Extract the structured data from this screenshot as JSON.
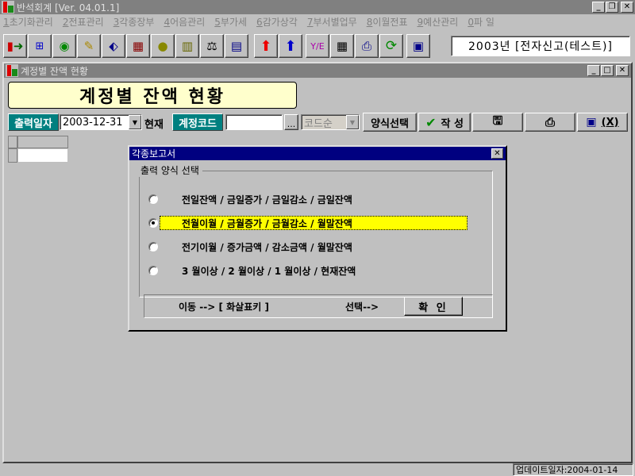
{
  "app": {
    "title": "반석회계 [Ver. 04.01.1]"
  },
  "menu": [
    {
      "key": "1",
      "label": "초기화관리"
    },
    {
      "key": "2",
      "label": "전표관리"
    },
    {
      "key": "3",
      "label": "각종장부"
    },
    {
      "key": "4",
      "label": "어음관리"
    },
    {
      "key": "5",
      "label": "부가세"
    },
    {
      "key": "6",
      "label": "감가상각"
    },
    {
      "key": "7",
      "label": "부서별업무"
    },
    {
      "key": "8",
      "label": "이월전표"
    },
    {
      "key": "9",
      "label": "예산관리"
    },
    {
      "key": "0",
      "label": "파 일"
    }
  ],
  "toolbar": {
    "icons": [
      "exit-icon",
      "org-chart-icon",
      "globe-icon",
      "pencil-edit-icon",
      "tag-icon",
      "abacus-icon",
      "coin-icon",
      "book-icon",
      "scale-icon",
      "grid-icon",
      "arrow-up-red-icon",
      "arrow-up-blue-icon",
      "year-end-icon",
      "calculator-icon",
      "printer-icon",
      "refresh-icon",
      "report-icon"
    ],
    "company": "2003년 [전자신고(테스트)]"
  },
  "window": {
    "title": "계정별 잔액 현황",
    "heading": "계정별 잔액 현황"
  },
  "filters": {
    "date_label": "출력일자",
    "date_value": "2003-12-31",
    "current_label": "현재",
    "code_label": "계정코드",
    "code_value": "",
    "lookup_label": "...",
    "sort_value": "코드순"
  },
  "actions": {
    "form_select": "양식선택",
    "write": "작 성",
    "exit": "(X)"
  },
  "dialog": {
    "title": "각종보고서",
    "group_label": "출력 양식 선택",
    "options": [
      {
        "label": "전일잔액 / 금일증가 / 금일감소 / 금일잔액",
        "selected": false
      },
      {
        "label": "전월이월 / 금월증가 / 금월감소 / 월말잔액",
        "selected": true
      },
      {
        "label": "전기이월 / 증가금액 / 감소금액 / 월말잔액",
        "selected": false
      },
      {
        "label": "3 월이상 / 2 월이상 / 1 월이상 / 현재잔액",
        "selected": false
      }
    ],
    "move_hint": "이동 --> [ 화살표키 ]",
    "select_hint": "선택-->",
    "ok_label": "확 인"
  },
  "status": {
    "update": "업데이트일자:2004-01-14"
  },
  "colors": {
    "accent_teal": "#008080",
    "highlight": "#ffff00",
    "dialog_title": "#000080",
    "heading_bg": "#ffffcc"
  }
}
